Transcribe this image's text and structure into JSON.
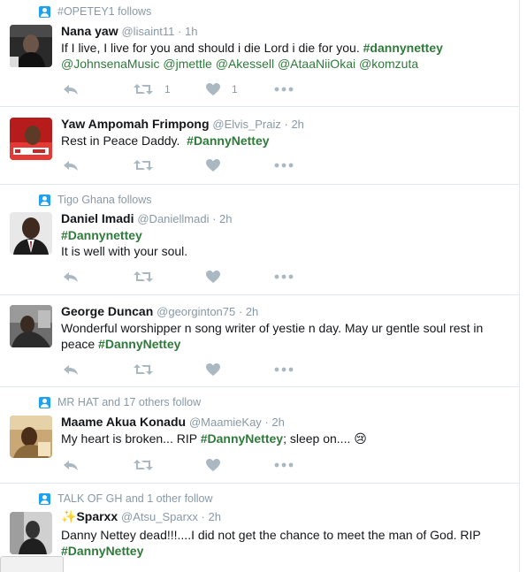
{
  "tweets": [
    {
      "context": "#OPETEY1 follows",
      "name": "Nana yaw",
      "handle": "@lisaint11",
      "sep": " · ",
      "time": "1h",
      "line1": {
        "text": "If I live, I live for you and should i die Lord i die for you. ",
        "tag": "#dannynettey"
      },
      "line2": [
        "@JohnsenaMusic",
        "@jmettle",
        "@Akessell",
        "@AtaaNiiOkai",
        "@komzuta"
      ],
      "retweets": "1",
      "likes": "1"
    },
    {
      "name": "Yaw Ampomah Frimpong",
      "handle": "@Elvis_Praiz",
      "sep": " · ",
      "time": "2h",
      "text": "Rest in Peace Daddy.  ",
      "tag": "#DannyNettey"
    },
    {
      "context": "Tigo Ghana follows",
      "name": "Daniel Imadi",
      "handle": "@Daniellmadi",
      "sep": " · ",
      "time": "2h",
      "tag": "#Dannynettey",
      "text": "It is well with your soul."
    },
    {
      "name": "George Duncan",
      "handle": "@georginton75",
      "sep": " · ",
      "time": "2h",
      "text": "Wonderful worshipper n song writer of yestie n day. May ur gentle soul rest in",
      "text2": "peace ",
      "tag": "#DannyNettey"
    },
    {
      "context": "MR HAT and 17 others follow",
      "name": "Maame Akua Konadu",
      "handle": "@MaamieKay",
      "sep": " · ",
      "time": "2h",
      "text": "My heart is broken... RIP ",
      "tag": "#DannyNettey",
      "text_after": "; sleep on.... ",
      "emoji": "😢"
    },
    {
      "context": "TALK OF GH and 1 other follow",
      "name_emoji": "✨",
      "name": "Sparxx",
      "handle": "@Atsu_Sparxx",
      "sep": " · ",
      "time": "2h",
      "text": "Danny Nettey dead!!!....I did not get the chance to meet the man of God. RIP",
      "tag": "#DannyNettey"
    }
  ],
  "colors": {
    "hashtag": "#2f7a3b",
    "muted": "#8899a6",
    "icon": "#aab8c2",
    "context_icon": "#1da1f2"
  },
  "icons": [
    "person-icon",
    "reply-icon",
    "retweet-icon",
    "like-icon",
    "more-icon"
  ]
}
